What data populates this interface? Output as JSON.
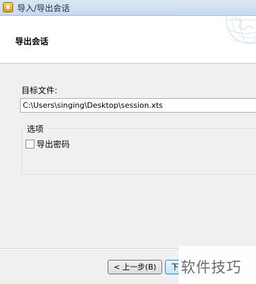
{
  "window": {
    "title": "导入/导出会话",
    "icon": "app-icon"
  },
  "header": {
    "title": "导出会话",
    "logo_icon": "globe-logo-icon"
  },
  "form": {
    "target_label": "目标文件:",
    "target_value": "C:\\Users\\singing\\Desktop\\session.xts"
  },
  "options": {
    "legend": "选项",
    "export_password_label": "导出密码",
    "export_password_checked": false
  },
  "buttons": {
    "back": "< 上一步(B)",
    "next": "下一"
  },
  "watermark": {
    "text": "软件技巧"
  },
  "colors": {
    "titlebar": "#c9d9ec",
    "dialog_bg": "#f0f0f0",
    "header_bg": "#ffffff",
    "next_button_border": "#3c7fb1"
  }
}
